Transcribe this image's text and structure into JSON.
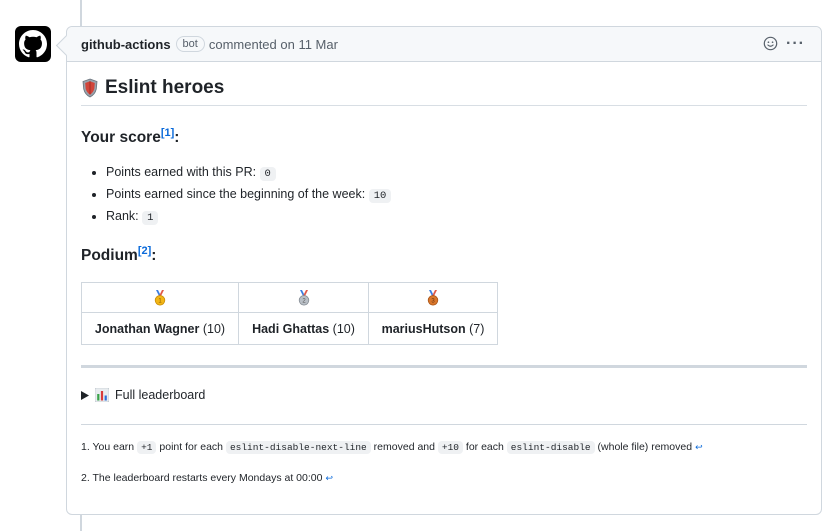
{
  "comment": {
    "author": "github-actions",
    "badge": "bot",
    "meta": "commented on 11 Mar",
    "menu_icon": "kebab-horizontal-icon"
  },
  "title": "Eslint heroes",
  "score": {
    "heading": "Your score",
    "footnote_ref": "[1]",
    "heading_suffix": ":",
    "items": [
      {
        "label": "Points earned with this PR: ",
        "value": "0"
      },
      {
        "label": "Points earned since the beginning of the week: ",
        "value": "10"
      },
      {
        "label": "Rank: ",
        "value": "1"
      }
    ]
  },
  "podium": {
    "heading": "Podium",
    "footnote_ref": "[2]",
    "heading_suffix": ":",
    "medals": [
      "gold-medal-icon",
      "silver-medal-icon",
      "bronze-medal-icon"
    ],
    "entries": [
      {
        "name": "Jonathan Wagner",
        "points": "(10)"
      },
      {
        "name": "Hadi Ghattas",
        "points": "(10)"
      },
      {
        "name": "mariusHutson",
        "points": "(7)"
      }
    ]
  },
  "leaderboard": {
    "label": "Full leaderboard"
  },
  "footnotes": {
    "one": {
      "prefix": "1. You earn ",
      "code1": "+1",
      "mid1": " point for each ",
      "code2": "eslint-disable-next-line",
      "mid2": " removed and ",
      "code3": "+10",
      "mid3": " for each ",
      "code4": "eslint-disable",
      "suffix": " (whole file) removed"
    },
    "two": {
      "text": "2. The leaderboard restarts every Mondays at 00:00"
    },
    "backref": "↩"
  },
  "colors": {
    "link": "#0969da",
    "border": "#d0d7de",
    "header_bg": "#f6f8fa"
  }
}
